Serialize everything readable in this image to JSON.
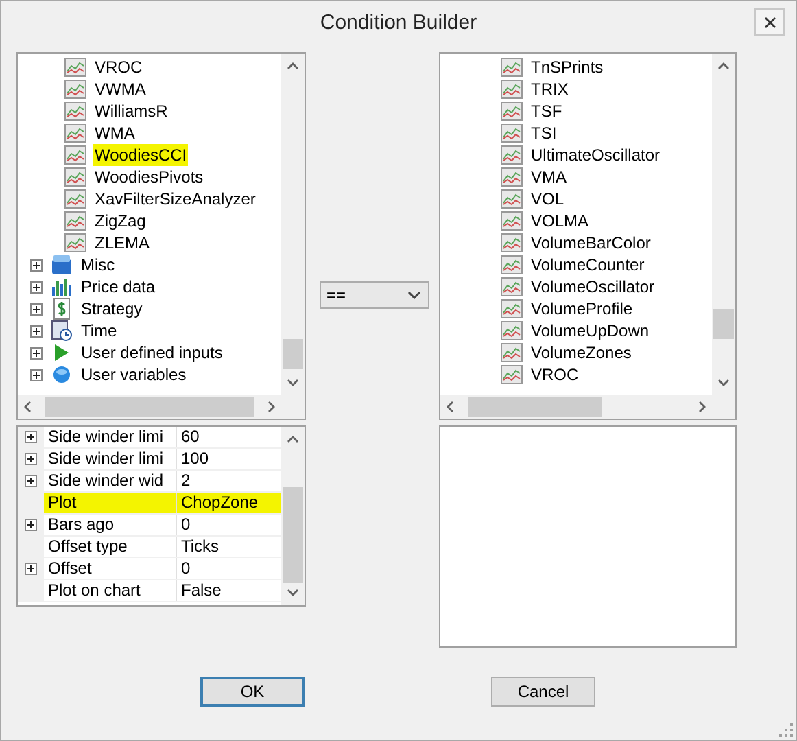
{
  "window": {
    "title": "Condition Builder"
  },
  "left_tree": {
    "items": [
      {
        "kind": "indicator",
        "label": "VROC",
        "highlighted": false
      },
      {
        "kind": "indicator",
        "label": "VWMA",
        "highlighted": false
      },
      {
        "kind": "indicator",
        "label": "WilliamsR",
        "highlighted": false
      },
      {
        "kind": "indicator",
        "label": "WMA",
        "highlighted": false
      },
      {
        "kind": "indicator",
        "label": "WoodiesCCI",
        "highlighted": true
      },
      {
        "kind": "indicator",
        "label": "WoodiesPivots",
        "highlighted": false
      },
      {
        "kind": "indicator",
        "label": "XavFilterSizeAnalyzer",
        "highlighted": false
      },
      {
        "kind": "indicator",
        "label": "ZigZag",
        "highlighted": false
      },
      {
        "kind": "indicator",
        "label": "ZLEMA",
        "highlighted": false
      },
      {
        "kind": "category",
        "label": "Misc",
        "expanded": false
      },
      {
        "kind": "category",
        "label": "Price data",
        "expanded": false
      },
      {
        "kind": "category",
        "label": "Strategy",
        "expanded": false
      },
      {
        "kind": "category",
        "label": "Time",
        "expanded": false
      },
      {
        "kind": "category",
        "label": "User defined inputs",
        "expanded": false
      },
      {
        "kind": "category",
        "label": "User variables",
        "expanded": false
      }
    ]
  },
  "properties": [
    {
      "name": "Side winder limi",
      "value": "60",
      "expandable": true,
      "highlighted": false
    },
    {
      "name": "Side winder limi",
      "value": "100",
      "expandable": true,
      "highlighted": false
    },
    {
      "name": "Side winder wid",
      "value": "2",
      "expandable": true,
      "highlighted": false
    },
    {
      "name": "Plot",
      "value": "ChopZone",
      "expandable": false,
      "highlighted": true
    },
    {
      "name": "Bars ago",
      "value": "0",
      "expandable": true,
      "highlighted": false
    },
    {
      "name": "Offset type",
      "value": "Ticks",
      "expandable": false,
      "highlighted": false
    },
    {
      "name": "Offset",
      "value": "0",
      "expandable": true,
      "highlighted": false
    },
    {
      "name": "Plot on chart",
      "value": "False",
      "expandable": false,
      "highlighted": false
    }
  ],
  "operator": {
    "value": "=="
  },
  "right_tree": {
    "items": [
      {
        "kind": "indicator",
        "label": "TnSPrints"
      },
      {
        "kind": "indicator",
        "label": "TRIX"
      },
      {
        "kind": "indicator",
        "label": "TSF"
      },
      {
        "kind": "indicator",
        "label": "TSI"
      },
      {
        "kind": "indicator",
        "label": "UltimateOscillator"
      },
      {
        "kind": "indicator",
        "label": "VMA"
      },
      {
        "kind": "indicator",
        "label": "VOL"
      },
      {
        "kind": "indicator",
        "label": "VOLMA"
      },
      {
        "kind": "indicator",
        "label": "VolumeBarColor"
      },
      {
        "kind": "indicator",
        "label": "VolumeCounter"
      },
      {
        "kind": "indicator",
        "label": "VolumeOscillator"
      },
      {
        "kind": "indicator",
        "label": "VolumeProfile"
      },
      {
        "kind": "indicator",
        "label": "VolumeUpDown"
      },
      {
        "kind": "indicator",
        "label": "VolumeZones"
      },
      {
        "kind": "indicator",
        "label": "VROC"
      }
    ]
  },
  "buttons": [
    {
      "label": "OK",
      "default": true
    },
    {
      "label": "Cancel",
      "default": false
    }
  ]
}
